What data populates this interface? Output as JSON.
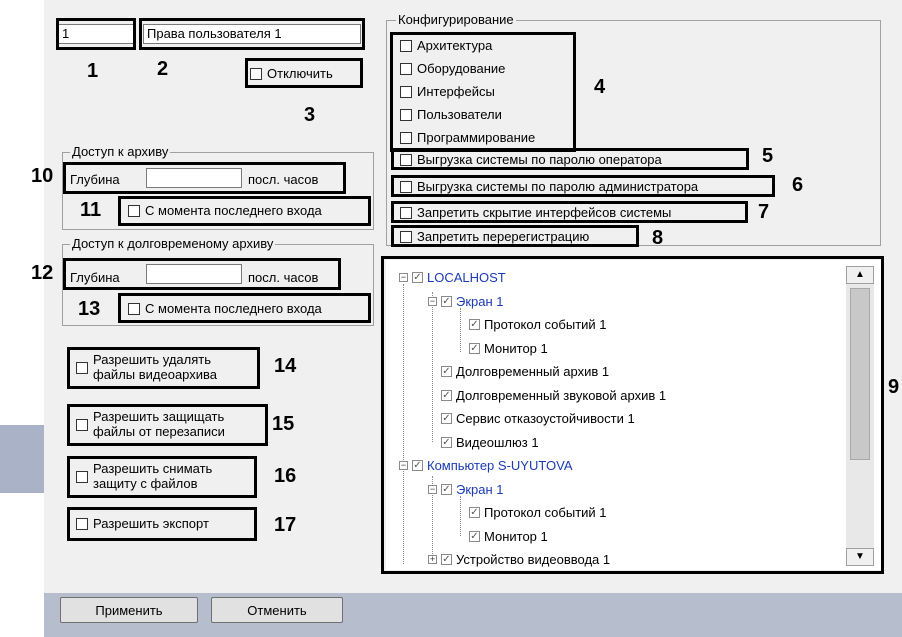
{
  "user": {
    "id": "1",
    "name": "Права пользователя 1",
    "disable_label": "Отключить"
  },
  "archive": {
    "title": "Доступ к архиву",
    "depth_label": "Глубина",
    "depth_value": "",
    "hours_label": "посл. часов",
    "since_login_label": "С момента последнего входа"
  },
  "long_archive": {
    "title": "Доступ к долговременому архиву",
    "depth_label": "Глубина",
    "depth_value": "",
    "hours_label": "посл. часов",
    "since_login_label": "С момента последнего входа"
  },
  "permissions": {
    "delete_line1": "Разрешить удалять",
    "delete_line2": "файлы видеоархива",
    "protect_line1": "Разрешить защищать",
    "protect_line2": "файлы от перезаписи",
    "unprotect_line1": "Разрешить снимать",
    "unprotect_line2": "защиту с файлов",
    "export": "Разрешить экспорт"
  },
  "config": {
    "title": "Конфигурирование",
    "items": [
      "Архитектура",
      "Оборудование",
      "Интерфейсы",
      "Пользователи",
      "Программирование"
    ],
    "upload_operator": "Выгрузка системы по паролю оператора",
    "upload_admin": "Выгрузка системы по паролю администратора",
    "hide_interfaces": "Запретить скрытие интерфейсов системы",
    "reregister": "Запретить перерегистрацию"
  },
  "tree": [
    {
      "label": "LOCALHOST",
      "level": 0,
      "blue": true,
      "expander": "−"
    },
    {
      "label": "Экран 1",
      "level": 1,
      "blue": true,
      "expander": "−"
    },
    {
      "label": "Протокол событий 1",
      "level": 2,
      "blue": false,
      "expander": ""
    },
    {
      "label": "Монитор 1",
      "level": 2,
      "blue": false,
      "expander": ""
    },
    {
      "label": "Долговременный архив 1",
      "level": 1,
      "blue": false,
      "expander": ""
    },
    {
      "label": "Долговременный звуковой архив 1",
      "level": 1,
      "blue": false,
      "expander": ""
    },
    {
      "label": "Сервис отказоустойчивости 1",
      "level": 1,
      "blue": false,
      "expander": ""
    },
    {
      "label": "Видеошлюз 1",
      "level": 1,
      "blue": false,
      "expander": ""
    },
    {
      "label": "Компьютер S-UYUTOVA",
      "level": 0,
      "blue": true,
      "expander": "−"
    },
    {
      "label": "Экран 1",
      "level": 1,
      "blue": true,
      "expander": "−"
    },
    {
      "label": "Протокол событий 1",
      "level": 2,
      "blue": false,
      "expander": ""
    },
    {
      "label": "Монитор 1",
      "level": 2,
      "blue": false,
      "expander": ""
    },
    {
      "label": "Устройство видеоввода 1",
      "level": 1,
      "blue": false,
      "expander": "+"
    }
  ],
  "callouts": [
    "1",
    "2",
    "3",
    "4",
    "5",
    "6",
    "7",
    "8",
    "9",
    "10",
    "11",
    "12",
    "13",
    "14",
    "15",
    "16",
    "17"
  ],
  "buttons": {
    "apply": "Применить",
    "cancel": "Отменить"
  },
  "colors": {
    "panel": "#f0f0f0",
    "bottom_bar": "#b6bdcd",
    "tree_blue": "#1a3bb5",
    "highlight": "#000000"
  },
  "icons": {
    "checkbox": "checkbox-icon",
    "checked": "check-icon",
    "expander": "tree-expander-icon",
    "scroll_up": "arrow-up-icon",
    "scroll_down": "arrow-down-icon"
  }
}
